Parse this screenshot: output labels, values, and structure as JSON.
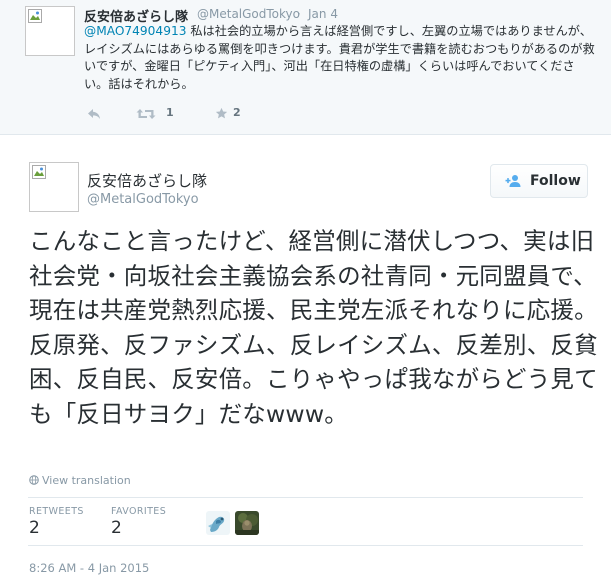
{
  "parent_tweet": {
    "display_name": "反安倍あざらし隊",
    "handle": "@MetalGodTokyo",
    "separator": "·",
    "date": "Jan 4",
    "mention": "@MAO74904913",
    "text": " 私は社会的立場から言えば経営側ですし、左翼の立場ではありませんが、レイシズムにはあらゆる罵倒を叩きつけます。貴君が学生で書籍を読むおつもりがあるのが救いですが、金曜日「ピケティ入門」、河出「在日特権の虚構」くらいは呼んでおいてください。話はそれから。",
    "actions": {
      "reply_icon": "reply-icon",
      "retweet_icon": "retweet-icon",
      "retweet_count": "1",
      "favorite_icon": "star-icon",
      "favorite_count": "2"
    }
  },
  "main_tweet": {
    "display_name": "反安倍あざらし隊",
    "handle": "@MetalGodTokyo",
    "follow_label": "Follow",
    "text": "こんなこと言ったけど、経営側に潜伏しつつ、実は旧社会党・向坂社会主義協会系の社青同・元同盟員で、現在は共産党熱烈応援、民主党左派それなりに応援。反原発、反ファシズム、反レイシズム、反差別、反貧困、反自民、反安倍。こりゃやっぱ我ながらどう見ても「反日サヨク」だなwww。",
    "view_translation": "View translation",
    "stats": {
      "retweets_label": "RETWEETS",
      "retweets_value": "2",
      "favorites_label": "FAVORITES",
      "favorites_value": "2"
    },
    "timestamp": "8:26 AM - 4 Jan 2015"
  },
  "colors": {
    "link": "#0084b4",
    "muted": "#8899a6",
    "text": "#292f33",
    "parent_bg": "#f5f8fa",
    "border": "#e1e8ed"
  }
}
